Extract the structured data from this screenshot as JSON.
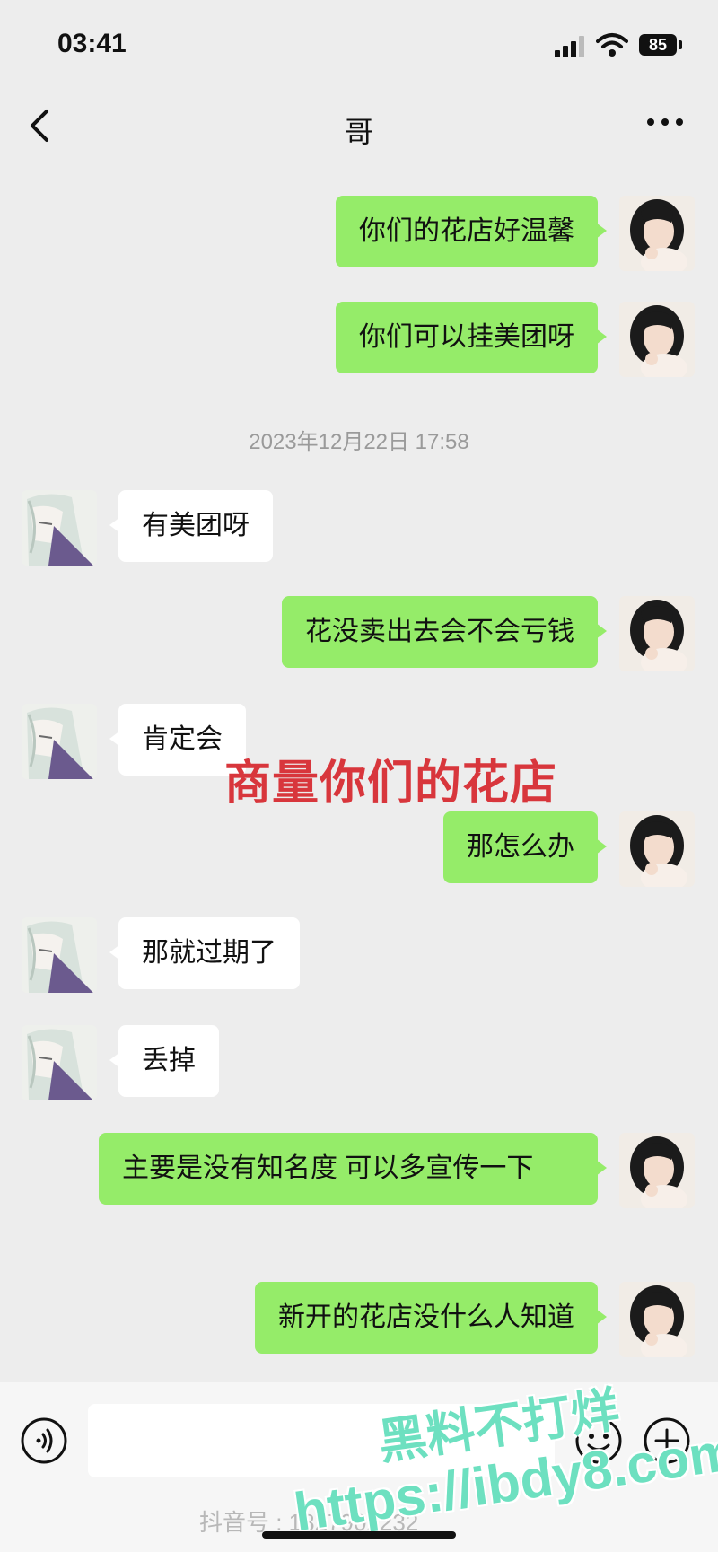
{
  "status_bar": {
    "time": "03:41",
    "battery": "85"
  },
  "nav": {
    "title": "哥"
  },
  "messages": [
    {
      "from": "me",
      "text": "你们的花店好温馨"
    },
    {
      "from": "me",
      "text": "你们可以挂美团呀"
    },
    {
      "from": "other",
      "text": "有美团呀"
    },
    {
      "from": "me",
      "text": "花没卖出去会不会亏钱"
    },
    {
      "from": "other",
      "text": "肯定会"
    },
    {
      "from": "me",
      "text": "那怎么办"
    },
    {
      "from": "other",
      "text": "那就过期了"
    },
    {
      "from": "other",
      "text": "丢掉"
    },
    {
      "from": "me",
      "text": "主要是没有知名度 可以多宣传一下"
    },
    {
      "from": "me",
      "text": "新开的花店没什么人知道"
    }
  ],
  "timestamp": "2023年12月22日 17:58",
  "overlay_caption": "商量你们的花店",
  "watermarks": {
    "line1": "黑料不打烊",
    "line2": "https://ibdy8.com",
    "tiktok": "抖音号 : 1827902232"
  },
  "colors": {
    "my_bubble": "#95ec69",
    "other_bubble": "#ffffff",
    "background": "#ededed",
    "caption": "#d8363c"
  },
  "icons": [
    "back-icon",
    "more-icon",
    "voice-icon",
    "emoji-icon",
    "plus-icon"
  ]
}
